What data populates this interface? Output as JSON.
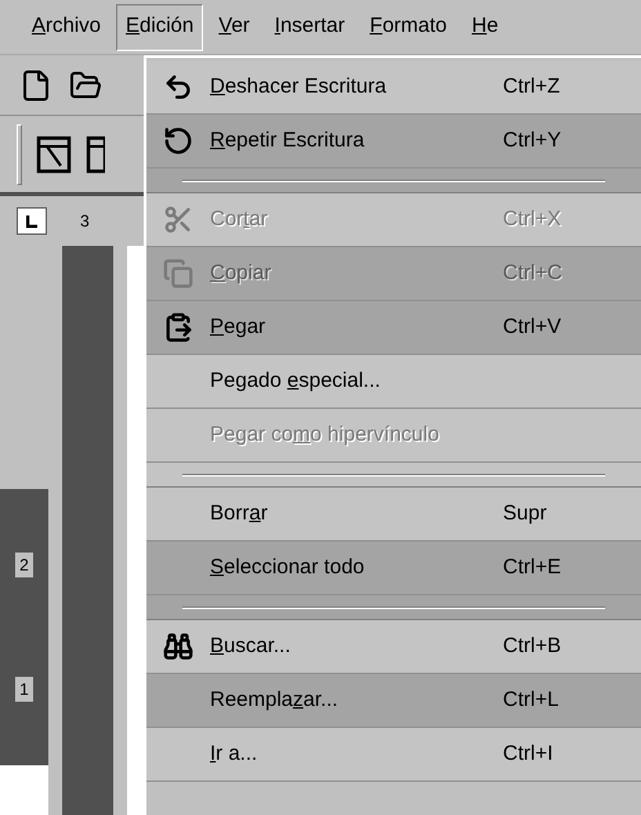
{
  "menubar": [
    {
      "key": "A",
      "post": "rchivo",
      "selected": false
    },
    {
      "key": "E",
      "post": "dición",
      "selected": true
    },
    {
      "key": "V",
      "post": "er",
      "selected": false
    },
    {
      "key": "I",
      "post": "nsertar",
      "selected": false
    },
    {
      "key": "F",
      "post": "ormato",
      "selected": false
    },
    {
      "key": "H",
      "post": "e",
      "selected": false
    }
  ],
  "ruler": {
    "horizontal_label": "3",
    "vertical_labels": [
      "2",
      "1"
    ]
  },
  "menu": [
    {
      "kind": "undo",
      "key": "D",
      "post": "eshacer Escritura",
      "shortcut": "Ctrl+Z",
      "disabled": false,
      "shaded": false
    },
    {
      "kind": "redo",
      "key": "R",
      "post": "epetir Escritura",
      "shortcut": "Ctrl+Y",
      "disabled": false,
      "shaded": true
    },
    {
      "kind": "separator",
      "shaded": true
    },
    {
      "kind": "cut",
      "pre": "Cor",
      "key": "t",
      "post": "ar",
      "shortcut": "Ctrl+X",
      "disabled": true,
      "shaded": false
    },
    {
      "kind": "copy",
      "key": "C",
      "post": "opiar",
      "shortcut": "Ctrl+C",
      "disabled": true,
      "shaded": true
    },
    {
      "kind": "paste",
      "key": "P",
      "post": "egar",
      "shortcut": "Ctrl+V",
      "disabled": false,
      "shaded": true
    },
    {
      "kind": "command",
      "pre": "Pegado ",
      "key": "e",
      "post": "special...",
      "disabled": false,
      "shaded": false
    },
    {
      "kind": "command",
      "pre": "Pegar co",
      "key": "m",
      "post": "o hipervínculo",
      "disabled": true,
      "shaded": false
    },
    {
      "kind": "separator",
      "shaded": false
    },
    {
      "kind": "command",
      "pre": "Borr",
      "key": "a",
      "post": "r",
      "shortcut": "Supr",
      "disabled": false,
      "shaded": false
    },
    {
      "kind": "command",
      "key": "S",
      "post": "eleccionar todo",
      "shortcut": "Ctrl+E",
      "disabled": false,
      "shaded": true
    },
    {
      "kind": "separator",
      "shaded": true
    },
    {
      "kind": "find",
      "key": "B",
      "post": "uscar...",
      "shortcut": "Ctrl+B",
      "disabled": false,
      "shaded": false
    },
    {
      "kind": "command",
      "pre": "Reempla",
      "key": "z",
      "post": "ar...",
      "shortcut": "Ctrl+L",
      "disabled": false,
      "shaded": true
    },
    {
      "kind": "command",
      "key": "I",
      "post": "r a...",
      "shortcut": "Ctrl+I",
      "disabled": false,
      "shaded": false
    }
  ]
}
